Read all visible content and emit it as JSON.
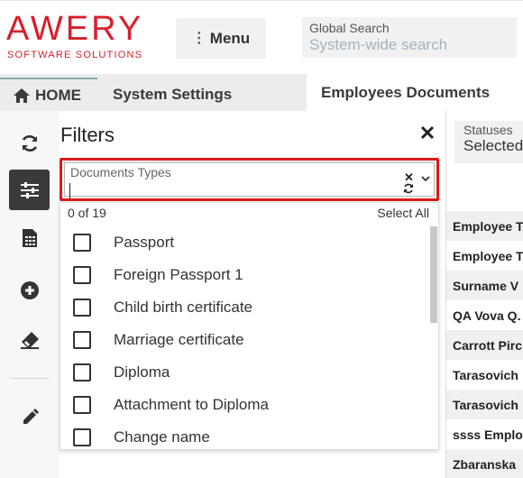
{
  "header": {
    "logo_main": "AWERY",
    "logo_sub": "SOFTWARE SOLUTIONS",
    "menu_label": "Menu",
    "search_label": "Global Search",
    "search_placeholder": "System-wide search"
  },
  "tabs": [
    {
      "label": "HOME"
    },
    {
      "label": "System Settings"
    },
    {
      "label": "Employees Documents"
    }
  ],
  "rail": {
    "icons": [
      "refresh-icon",
      "filters-icon",
      "spreadsheet-icon",
      "add-icon",
      "eraser-icon",
      "edit-icon"
    ]
  },
  "filters": {
    "title": "Filters",
    "doc_types_label": "Documents Types",
    "count": "0 of 19",
    "select_all": "Select All",
    "items": [
      {
        "label": "Passport",
        "checked": false
      },
      {
        "label": "Foreign Passport 1",
        "checked": false
      },
      {
        "label": "Child birth certificate",
        "checked": false
      },
      {
        "label": "Marriage certificate",
        "checked": false
      },
      {
        "label": "Diploma",
        "checked": false
      },
      {
        "label": "Attachment to Diploma",
        "checked": false
      },
      {
        "label": "Change name",
        "checked": false
      }
    ]
  },
  "right": {
    "statuses_label": "Statuses",
    "statuses_value": "Selected",
    "rows": [
      "Employee T",
      "Employee T",
      "Surname V",
      "QA Vova Q.",
      "Carrott Pirc",
      "Tarasovich",
      "Tarasovich",
      "ssss Emplo",
      "Zbaranska"
    ]
  },
  "colors": {
    "brand": "#d71f2b",
    "highlight": "#e01818",
    "rail_active": "#3a3a3a"
  }
}
